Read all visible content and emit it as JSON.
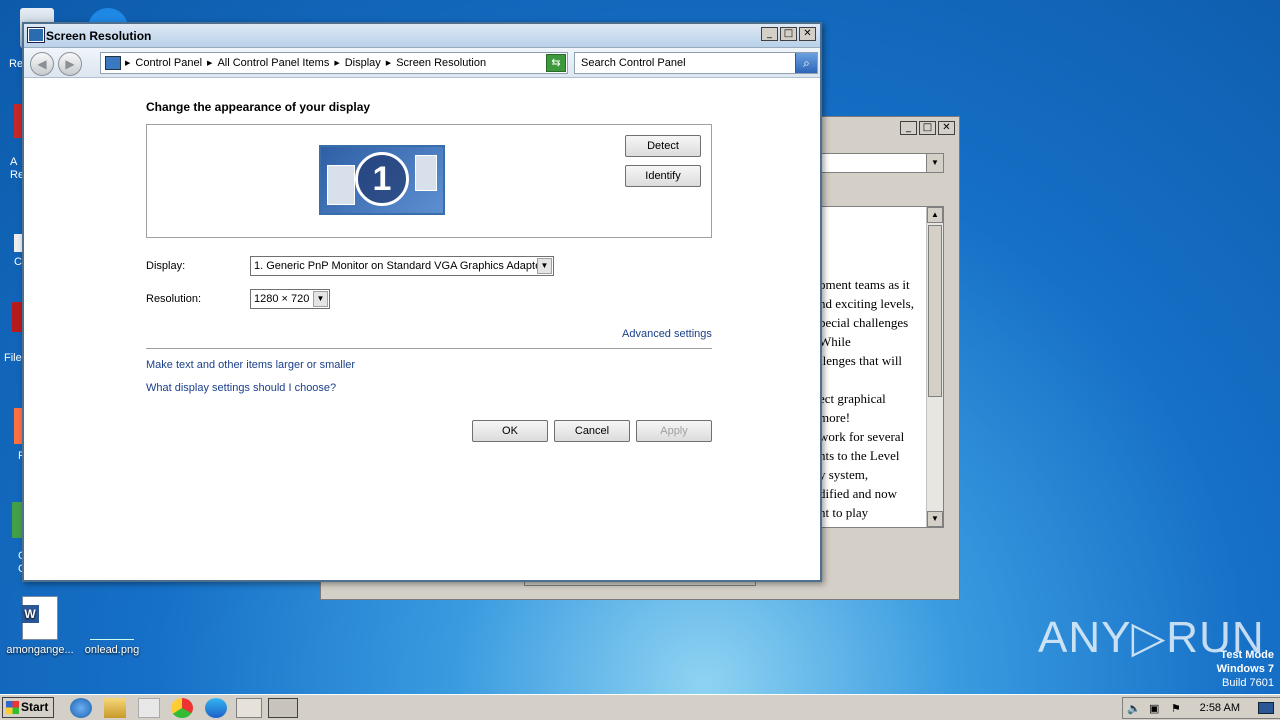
{
  "desktop": {
    "icons": [
      {
        "label": "amongange...",
        "type": "word-doc-icon"
      },
      {
        "label": "onlead.png",
        "type": "image-file-icon"
      }
    ],
    "partial_labels": {
      "recycle": "Re",
      "acrobat": "A\nRe",
      "c": "C",
      "filez": "File",
      "f": "F",
      "chrome": "G\nC"
    }
  },
  "background_window": {
    "text_lines": [
      "pment teams as it",
      "nd exciting levels,",
      "pecial challenges",
      "While",
      "llenges that will",
      "",
      "ect graphical",
      "more!",
      " work for several",
      "nts to the Level",
      "y system,",
      "dified and now",
      "nt to play"
    ]
  },
  "window": {
    "title": "Screen Resolution",
    "breadcrumbs": [
      "Control Panel",
      "All Control Panel Items",
      "Display",
      "Screen Resolution"
    ],
    "search_placeholder": "Search Control Panel",
    "heading": "Change the appearance of your display",
    "monitor_number": "1",
    "detect_label": "Detect",
    "identify_label": "Identify",
    "display_label": "Display:",
    "display_value": "1. Generic PnP Monitor on Standard VGA Graphics Adapter",
    "resolution_label": "Resolution:",
    "resolution_value": "1280 × 720",
    "advanced_link": "Advanced settings",
    "link_text_size": "Make text and other items larger or smaller",
    "link_help": "What display settings should I choose?",
    "ok_label": "OK",
    "cancel_label": "Cancel",
    "apply_label": "Apply"
  },
  "watermark": {
    "brand": "ANY▷RUN",
    "line1": "Test Mode",
    "line2": "Windows 7",
    "line3": "Build 7601"
  },
  "taskbar": {
    "start_label": "Start",
    "clock": "2:58 AM"
  },
  "colors": {
    "accent_link": "#1a3f8a",
    "desktop": "#1670c7"
  }
}
